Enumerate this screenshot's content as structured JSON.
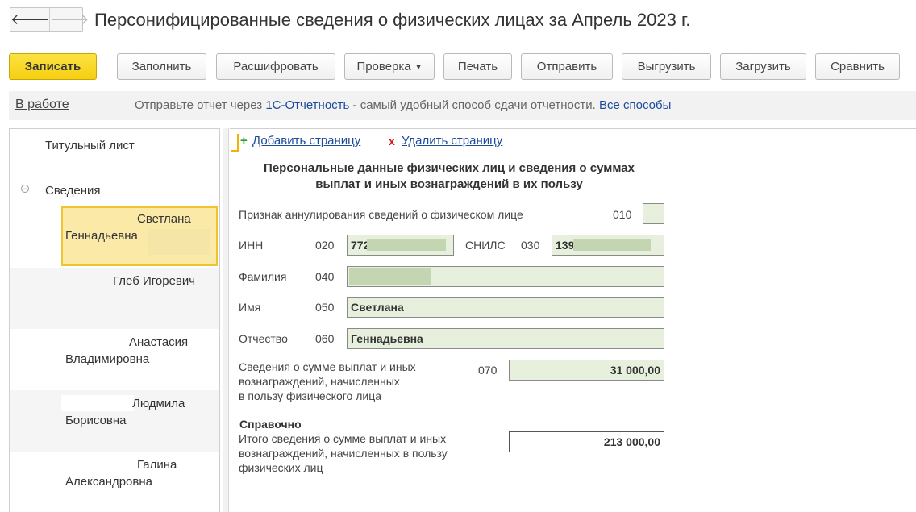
{
  "header": {
    "back_icon": "arrow-left-icon",
    "forward_icon": "arrow-right-icon",
    "title": "Персонифицированные сведения о физических лицах за Апрель 2023 г."
  },
  "toolbar": {
    "save": "Записать",
    "fill": "Заполнить",
    "decode": "Расшифровать",
    "check": "Проверка",
    "print": "Печать",
    "send": "Отправить",
    "export": "Выгрузить",
    "import": "Загрузить",
    "compare": "Сравнить"
  },
  "status": {
    "state": "В работе",
    "message_prefix": "Отправьте отчет через",
    "service_link": "1С-Отчетность",
    "message_suffix": "- самый удобный способ сдачи отчетности.",
    "all_ways_link": "Все способы"
  },
  "tree": {
    "title_page": "Титульный лист",
    "section": "Сведения",
    "items": [
      {
        "line1": "Светлана",
        "line2": "Геннадьевна"
      },
      {
        "line1": "Глеб Игоревич",
        "line2": ""
      },
      {
        "line1": "Анастасия",
        "line2": "Владимировна"
      },
      {
        "line1": "Людмила",
        "line2": "Борисовна"
      },
      {
        "line1": "Галина",
        "line2": "Александровна"
      }
    ]
  },
  "form": {
    "add_page": "Добавить страницу",
    "delete_page": "Удалить страницу",
    "heading_line1": "Персональные данные физических лиц и сведения о суммах",
    "heading_line2": "выплат и иных вознаграждений в их пользу",
    "cancel_label": "Признак аннулирования сведений о физическом лице",
    "cancel_code": "010",
    "inn_label": "ИНН",
    "inn_code": "020",
    "inn_value": "772",
    "snils_label": "СНИЛС",
    "snils_code": "030",
    "snils_value": "139",
    "surname_label": "Фамилия",
    "surname_code": "040",
    "name_label": "Имя",
    "name_code": "050",
    "name_value": "Светлана",
    "patronymic_label": "Отчество",
    "patronymic_code": "060",
    "patronymic_value": "Геннадьевна",
    "payments_label_1": "Сведения о сумме выплат и иных",
    "payments_label_2": "вознаграждений, начисленных",
    "payments_label_3": "в пользу физического лица",
    "payments_code": "070",
    "payments_value": "31 000,00",
    "reference_title": "Справочно",
    "total_label_1": "Итого сведения о сумме выплат и иных",
    "total_label_2": "вознаграждений, начисленных в пользу",
    "total_label_3": "физических лиц",
    "total_value": "213 000,00"
  },
  "colors": {
    "primary_button": "#f6cf12",
    "field_bg": "#e6f0dc",
    "link": "#1d4b9b",
    "selection": "#fbe9a8"
  }
}
